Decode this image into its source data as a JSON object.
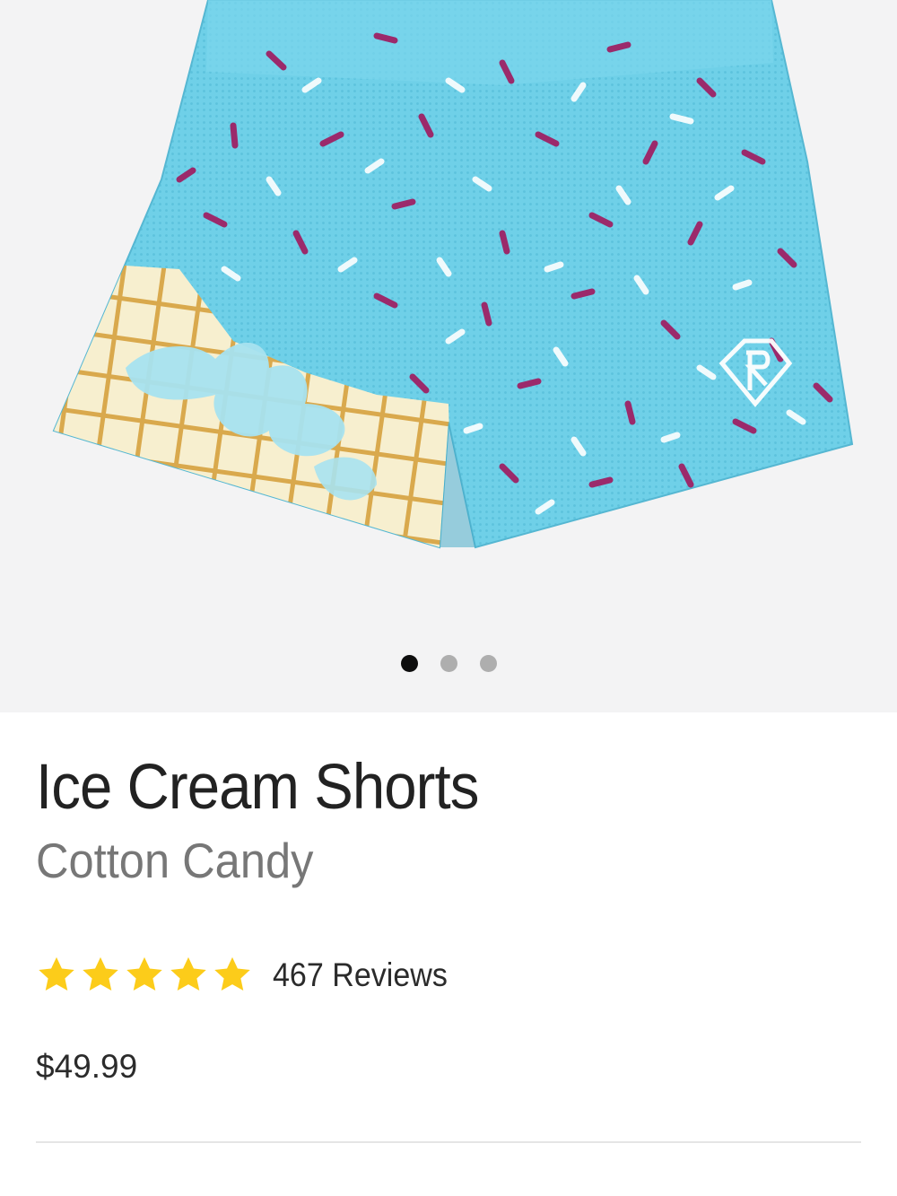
{
  "product": {
    "title": "Ice Cream Shorts",
    "variant": "Cotton Candy",
    "rating": 5,
    "rating_max": 5,
    "reviews_label": "467 Reviews",
    "price": "$49.99",
    "image_icon": "mesh-shorts-sprinkles-pattern",
    "logo_icon": "shield-logo-icon"
  },
  "gallery": {
    "slide_count": 3,
    "active_slide": 1
  },
  "colors": {
    "shorts_blue": "#6fd0e8",
    "sprinkle_purple": "#9b2a6b",
    "cone_tan": "#d9a94d",
    "star_yellow": "#fccc1a",
    "text_dark": "#222222",
    "text_muted": "#777777"
  }
}
